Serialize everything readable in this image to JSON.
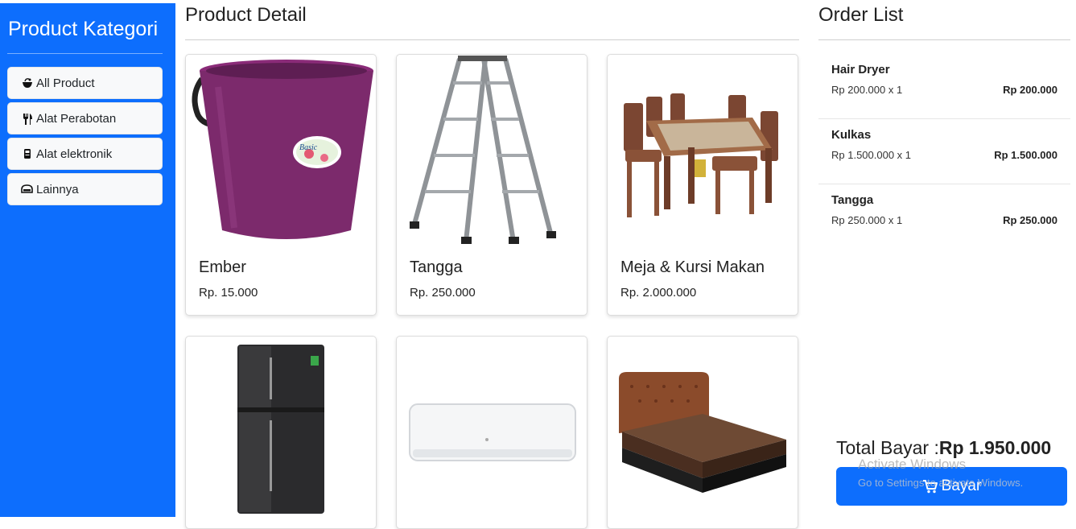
{
  "sidebar": {
    "title": "Product Kategori",
    "categories": [
      {
        "label": "All Product",
        "icon": "bowl-icon"
      },
      {
        "label": "Alat Perabotan",
        "icon": "utensils-icon"
      },
      {
        "label": "Alat elektronik",
        "icon": "electronics-icon"
      },
      {
        "label": "Lainnya",
        "icon": "misc-icon"
      }
    ]
  },
  "main": {
    "title": "Product Detail",
    "products": [
      {
        "name": "Ember",
        "price": "Rp. 15.000",
        "image": "purple-bucket"
      },
      {
        "name": "Tangga",
        "price": "Rp. 250.000",
        "image": "aluminium-ladder"
      },
      {
        "name": "Meja & Kursi Makan",
        "price": "Rp. 2.000.000",
        "image": "dining-table-set"
      },
      {
        "name": "",
        "price": "",
        "image": "refrigerator"
      },
      {
        "name": "",
        "price": "",
        "image": "air-conditioner"
      },
      {
        "name": "",
        "price": "",
        "image": "bed"
      }
    ]
  },
  "order": {
    "title": "Order List",
    "items": [
      {
        "name": "Hair Dryer",
        "qty_line": "Rp 200.000 x 1",
        "subtotal": "Rp 200.000"
      },
      {
        "name": "Kulkas",
        "qty_line": "Rp 1.500.000 x 1",
        "subtotal": "Rp 1.500.000"
      },
      {
        "name": "Tangga",
        "qty_line": "Rp 250.000 x 1",
        "subtotal": "Rp 250.000"
      }
    ],
    "total_label": "Total Bayar :",
    "total_value": "Rp 1.950.000",
    "pay_label": "Bayar",
    "pay_icon": "cart-icon"
  },
  "watermark": {
    "line1": "Activate Windows",
    "line2": "Go to Settings to activate Windows."
  },
  "colors": {
    "primary": "#0d6efd",
    "card_bg": "#ffffff",
    "button_light": "#f8f9fa"
  }
}
